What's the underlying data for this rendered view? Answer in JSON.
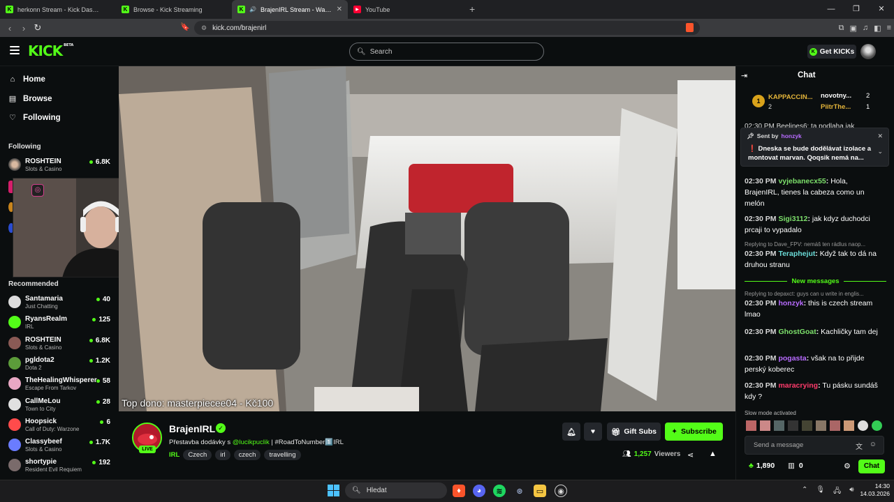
{
  "browser": {
    "tabs": [
      {
        "label": "herkonn Stream - Kick Dashboard",
        "icon": "kick-icon",
        "active": false
      },
      {
        "label": "Browse - Kick Streaming",
        "icon": "kick-icon",
        "active": false
      },
      {
        "label": "BrajenIRL Stream - Watch Live",
        "icon": "kick-icon",
        "active": true
      },
      {
        "label": "YouTube",
        "icon": "youtube-icon",
        "active": false
      }
    ],
    "url": "kick.com/brajenirl",
    "new_tab": "+"
  },
  "header": {
    "logo": "KICK",
    "logo_sup": "BETA",
    "search_placeholder": "Search",
    "get_kicks": "Get KICKs"
  },
  "sidebar": {
    "nav": [
      {
        "label": "Home",
        "icon": "home-icon"
      },
      {
        "label": "Browse",
        "icon": "browse-icon"
      },
      {
        "label": "Following",
        "icon": "heart-icon"
      }
    ],
    "following_title": "Following",
    "following": [
      {
        "name": "ROSHTEIN",
        "category": "Slots & Casino",
        "viewers": "6.8K"
      }
    ],
    "recommended_title": "Recommended",
    "recommended": [
      {
        "name": "Santamaria",
        "category": "Just Chatting",
        "viewers": "40"
      },
      {
        "name": "RyansRealm",
        "category": "IRL",
        "viewers": "125"
      },
      {
        "name": "ROSHTEIN",
        "category": "Slots & Casino",
        "viewers": "6.8K"
      },
      {
        "name": "pgldota2",
        "category": "Dota 2",
        "viewers": "1.2K"
      },
      {
        "name": "TheHealingWhisperer",
        "category": "Escape From Tarkov",
        "viewers": "58"
      },
      {
        "name": "CallMeLou",
        "category": "Town to City",
        "viewers": "28"
      },
      {
        "name": "Hoopsick",
        "category": "Call of Duty: Warzone",
        "viewers": "6"
      },
      {
        "name": "Classybeef",
        "category": "Slots & Casino",
        "viewers": "1.7K"
      },
      {
        "name": "shortypie",
        "category": "Resident Evil Requiem",
        "viewers": "192"
      }
    ]
  },
  "video": {
    "overlay_text": "Top dono: masterpiecee04 - Kč100"
  },
  "stream": {
    "channel": "BrajenIRL",
    "live": "LIVE",
    "title_pre": "Přestavba dodávky s ",
    "title_mention": "@lucikpuclik",
    "title_post": " | #RoadToNumber1️⃣IRL",
    "category": "IRL",
    "tags": [
      "Czech",
      "irl",
      "czech",
      "travelling"
    ],
    "viewers": "1,257",
    "viewers_label": "Viewers",
    "gift_subs": "Gift Subs",
    "subscribe": "Subscribe"
  },
  "chat": {
    "title": "Chat",
    "leaderboard": [
      {
        "rank": "1",
        "name": "KAPPACCIN...",
        "count": "2"
      },
      {
        "name": "novotny...",
        "count": "2"
      },
      {
        "name": "PiitrThe...",
        "count": "1"
      }
    ],
    "pinned_sent_by": "Sent by",
    "pinned_user": "honzyk",
    "pinned_text": "❗ Dneska se bude dodělávat izolace a montovat marvan. Qoqsik nemá na...",
    "behind_pinned": "02:30 PM  Beelines6: ta podlaha jak",
    "messages": [
      {
        "time": "02:30 PM",
        "user": "vyjebanecx55",
        "color": "#7de06b",
        "text": "Hola, BrajenIRL, tienes la cabeza como un melón"
      },
      {
        "time": "02:30 PM",
        "user": "Sigi3112",
        "color": "#7de06b",
        "text": "jak kdyz duchodci prcaji to vypadalo"
      },
      {
        "reply": "Replying to Dave_FPV: nemáš ten rádlus naop...",
        "time": "02:30 PM",
        "user": "Teraphejut",
        "color": "#6bdcd8",
        "text": "Když tak to dá na druhou stranu"
      },
      {
        "reply": "Replying to depaxct: guys can u write in englis...",
        "time": "02:30 PM",
        "user": "honzyk",
        "color": "#b86bff",
        "text": "this is czech stream lmao"
      },
      {
        "time": "02:30 PM",
        "user": "GhostGoat",
        "color": "#7de06b",
        "text": "Kachličky tam dej"
      },
      {
        "time": "02:30 PM",
        "user": "pogasta",
        "color": "#b86bff",
        "text": "však na to přijde perský koberec"
      },
      {
        "time": "02:30 PM",
        "user": "maracrying",
        "color": "#ff3b6b",
        "text": "Tu pásku sundáš kdy ?"
      }
    ],
    "new_messages": "New messages",
    "slow_mode": "Slow mode activated",
    "input_placeholder": "Send a message",
    "kicks_balance": "1,890",
    "points": "0",
    "send": "Chat"
  },
  "taskbar": {
    "search": "Hledat",
    "time": "14:30",
    "date": "14.03.2026"
  },
  "colors": {
    "accent": "#53fc18",
    "bg": "#0b0e0f",
    "panel": "#24272c"
  }
}
